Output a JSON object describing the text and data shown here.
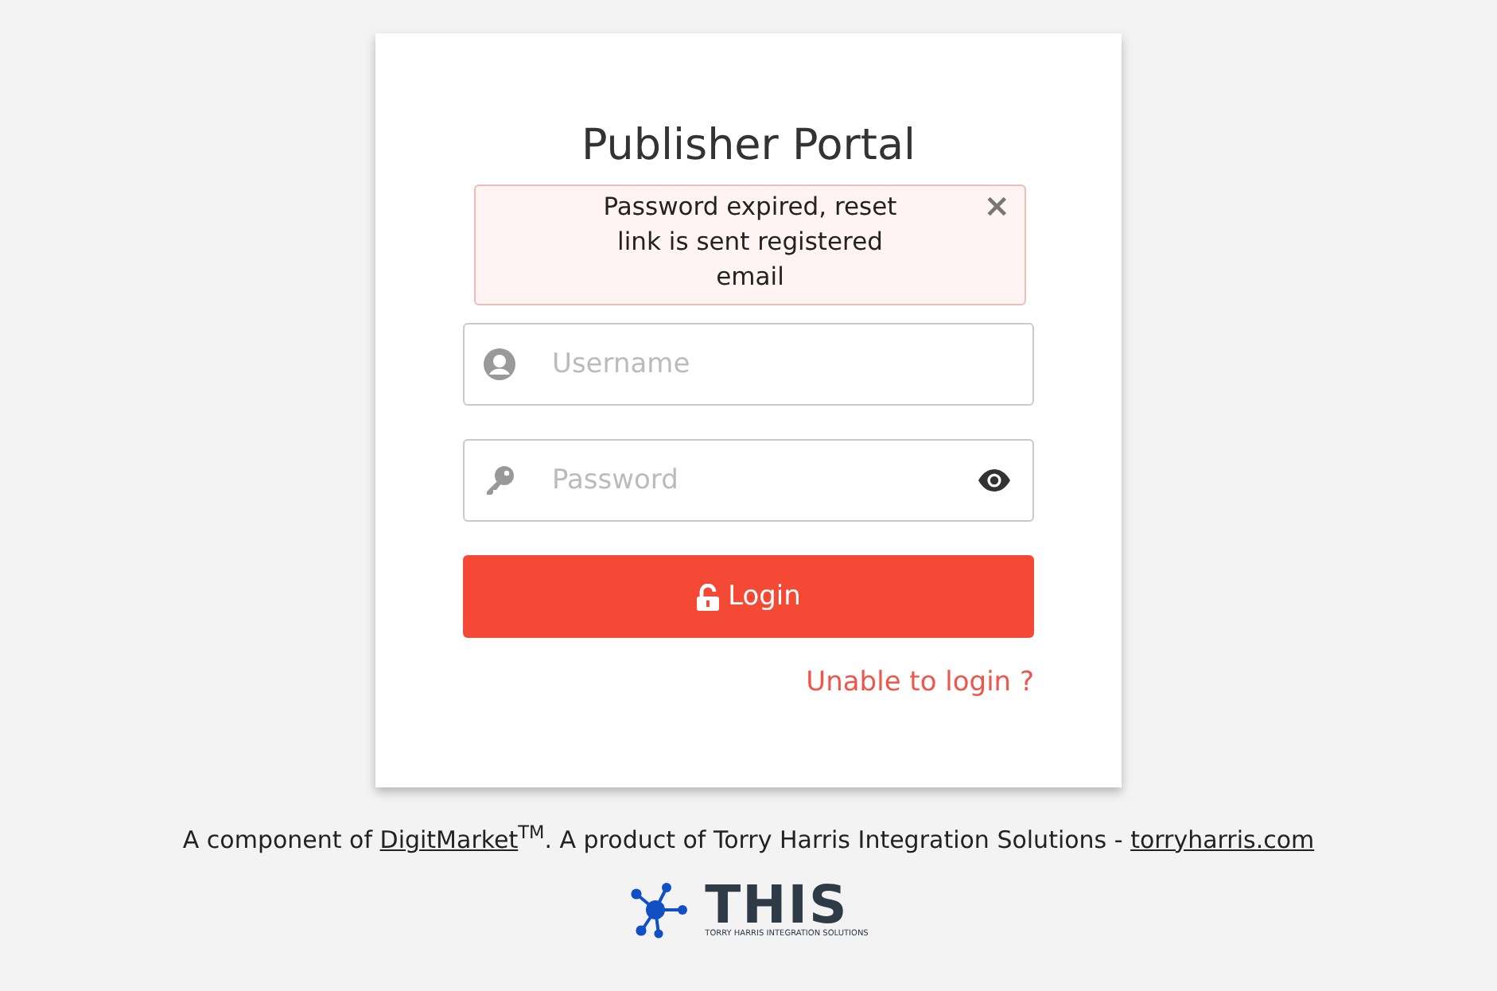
{
  "title": "Publisher Portal",
  "alert": {
    "message": "Password expired, reset link is sent registered email",
    "close": "×"
  },
  "fields": [
    {
      "kind": "user",
      "placeholder": "Username"
    },
    {
      "kind": "password",
      "placeholder": "Password"
    }
  ],
  "login_button": "Login",
  "help_link": "Unable to login ?",
  "footer": {
    "prefix": "A component of ",
    "link_1": "DigitMarket",
    "mark": "TM",
    "middle": ".  A product of Torry Harris Integration Solutions - ",
    "link_2": "torryharris.com"
  },
  "logo": {
    "name": "THIS",
    "tagline": "TORRY HARRIS INTEGRATION SOLUTIONS"
  }
}
